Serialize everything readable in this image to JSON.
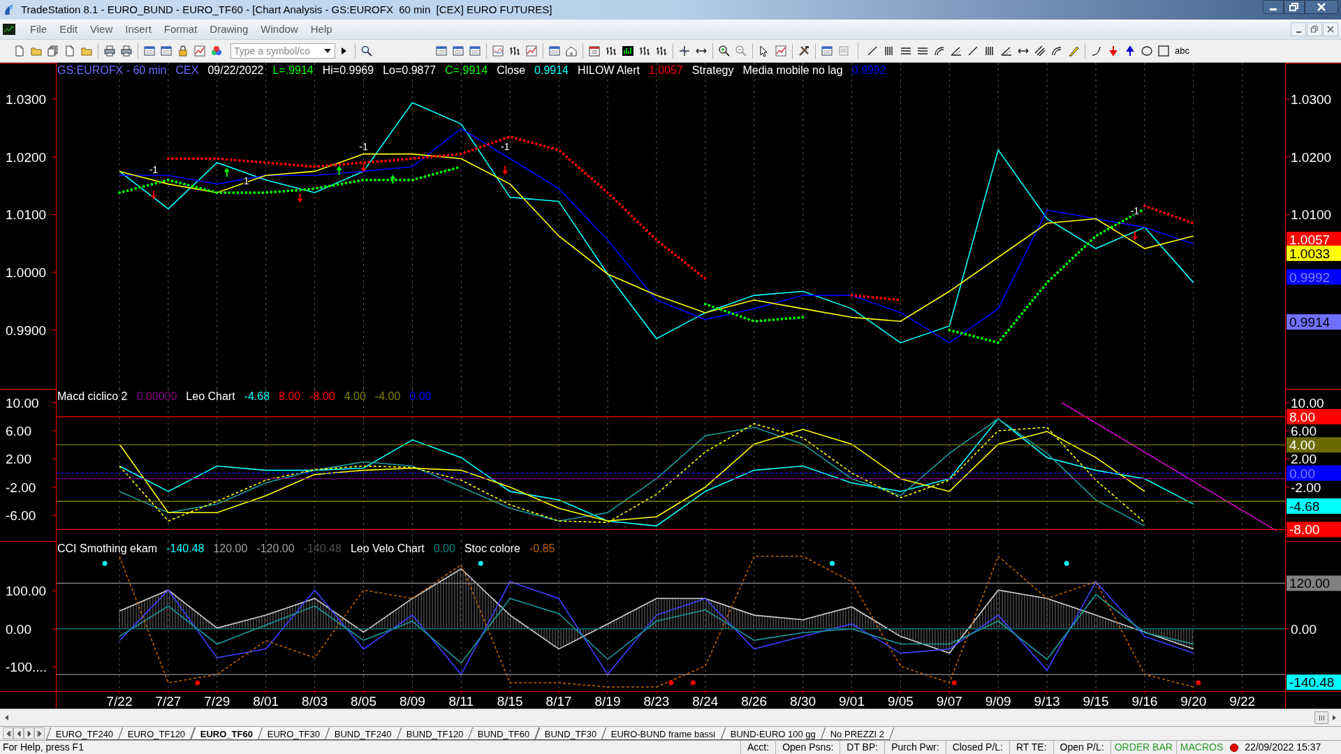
{
  "window": {
    "title": "TradeStation 8.1 - EURO_BUND - EURO_TF60 - [Chart Analysis - GS:EUROFX  60 min  [CEX] EURO FUTURES]"
  },
  "menu": [
    "File",
    "Edit",
    "View",
    "Insert",
    "Format",
    "Drawing",
    "Window",
    "Help"
  ],
  "toolbar": {
    "symbol_field": {
      "placeholder": "Type a symbol/co"
    },
    "text_tool": "abc"
  },
  "panels": [
    {
      "header": [
        {
          "text": "GS:EUROFX - 60 min",
          "color": "#6b6bff"
        },
        {
          "text": "CEX",
          "color": "#6b6bff"
        },
        {
          "text": "09/22/2022",
          "color": "#ffffff"
        },
        {
          "text": "L=.9914",
          "color": "#00ff00"
        },
        {
          "text": "Hi=0.9969",
          "color": "#ffffff"
        },
        {
          "text": "Lo=0.9877",
          "color": "#ffffff"
        },
        {
          "text": "C=.9914",
          "color": "#00ff00"
        },
        {
          "text": "Close",
          "color": "#ffffff"
        },
        {
          "text": "0.9914",
          "color": "#00ffff"
        },
        {
          "text": "HILOW Alert",
          "color": "#ffffff"
        },
        {
          "text": "1.0057",
          "color": "#ff0000"
        },
        {
          "text": "Strategy",
          "color": "#ffffff"
        },
        {
          "text": "Media mobile no lag",
          "color": "#ffffff"
        },
        {
          "text": "0.9992",
          "color": "#0000ff"
        }
      ],
      "signal_labels": [
        "-1",
        "1",
        "-1",
        "-1",
        "-1"
      ],
      "right_axis": [
        {
          "text": "1.0300",
          "kind": "tick"
        },
        {
          "text": "1.0200",
          "kind": "tick"
        },
        {
          "text": "1.0100",
          "kind": "tick"
        },
        {
          "text": "1.0057",
          "kind": "badge",
          "color": "#ff0000"
        },
        {
          "text": "1.0033",
          "kind": "badge",
          "color": "#ffff00"
        },
        {
          "text": "0.9992",
          "kind": "badge",
          "color": "#0000ff"
        },
        {
          "text": "0.9914",
          "kind": "badge",
          "color": "#7070ff"
        }
      ],
      "chart_data": {
        "type": "line",
        "grid": true,
        "ylim": [
          0.9798,
          1.0363
        ],
        "yticks": [
          {
            "value": 1.03,
            "label": "1.0300"
          },
          {
            "value": 1.02,
            "label": "1.0200"
          },
          {
            "value": 1.01,
            "label": "1.0100"
          },
          {
            "value": 1.0,
            "label": "1.0000"
          },
          {
            "value": 0.99,
            "label": "0.9900"
          }
        ],
        "series": [
          {
            "color": "#00ffff",
            "line_style": "solid",
            "values": [
              1.0175,
              1.011,
              1.019,
              1.016,
              1.0138,
              1.0175,
              1.0294,
              1.0257,
              1.013,
              1.0123,
              0.9997,
              0.9885,
              0.993,
              0.996,
              0.9967,
              0.9937,
              0.9878,
              0.9907,
              1.0212,
              1.0093,
              1.0041,
              1.0078,
              0.9982,
              null
            ]
          },
          {
            "color": "#0000ff",
            "line_style": "solid",
            "values": [
              1.0168,
              1.0168,
              1.0153,
              1.0168,
              1.0168,
              1.0175,
              1.0183,
              1.0249,
              1.0197,
              1.0145,
              1.0056,
              0.9952,
              0.9918,
              0.9937,
              0.996,
              0.996,
              0.993,
              0.9878,
              0.9937,
              1.0108,
              1.0093,
              1.0078,
              1.0049,
              null
            ]
          },
          {
            "color": "#ffff00",
            "line_style": "solid",
            "values": [
              1.0175,
              1.0153,
              1.0138,
              1.0168,
              1.0175,
              1.0205,
              1.0205,
              1.0197,
              1.0153,
              1.0063,
              0.9997,
              0.996,
              0.993,
              0.9952,
              0.9937,
              0.9922,
              0.9915,
              0.9967,
              1.0026,
              1.0085,
              1.0093,
              1.0041,
              1.0063,
              null
            ]
          },
          {
            "color": "#ff0000",
            "line_style": "dotted",
            "values": [
              null,
              1.0197,
              1.0197,
              1.019,
              1.0183,
              1.019,
              1.0197,
              1.0205,
              1.0235,
              1.0212,
              1.0138,
              1.0056,
              0.9989,
              null,
              null,
              0.996,
              0.9952,
              null,
              null,
              null,
              null,
              1.0115,
              1.0085,
              null
            ]
          },
          {
            "color": "#00ff00",
            "line_style": "dotted",
            "values": [
              1.0138,
              1.016,
              1.0138,
              1.0138,
              1.0145,
              1.016,
              1.016,
              1.0183,
              null,
              null,
              null,
              null,
              0.9945,
              0.9915,
              0.9922,
              null,
              null,
              0.99,
              0.9878,
              0.9982,
              1.0063,
              1.011,
              null,
              null
            ]
          }
        ]
      }
    },
    {
      "header": [
        {
          "text": "Macd ciclico 2",
          "color": "#ffffff"
        },
        {
          "text": "0.00000",
          "color": "#800080"
        },
        {
          "text": "Leo Chart",
          "color": "#ffffff"
        },
        {
          "text": "-4.68",
          "color": "#00ffff"
        },
        {
          "text": "8.00",
          "color": "#ff0000"
        },
        {
          "text": "-8.00",
          "color": "#ff0000"
        },
        {
          "text": "4.00",
          "color": "#808000"
        },
        {
          "text": "-4.00",
          "color": "#808000"
        },
        {
          "text": "0.00",
          "color": "#0000ff"
        }
      ],
      "right_axis": [
        {
          "text": "10.00",
          "kind": "tick"
        },
        {
          "text": "8.00",
          "kind": "badge",
          "color": "#ff0000"
        },
        {
          "text": "6.00",
          "kind": "tick"
        },
        {
          "text": "4.00",
          "kind": "badge",
          "color": "#6b6b00"
        },
        {
          "text": "2.00",
          "kind": "tick"
        },
        {
          "text": "0.00",
          "kind": "badge",
          "color": "#0000ff"
        },
        {
          "text": "-2.00",
          "kind": "tick"
        },
        {
          "text": "-4.68",
          "kind": "badge",
          "color": "#00ffff"
        },
        {
          "text": "-8.00",
          "kind": "badge",
          "color": "#ff0000"
        }
      ],
      "chart_data": {
        "type": "line",
        "grid": true,
        "ylim": [
          -9.64,
          11.94
        ],
        "yticks": [
          {
            "value": 10,
            "label": "10.00"
          },
          {
            "value": 6,
            "label": "6.00"
          },
          {
            "value": 2,
            "label": "2.00"
          },
          {
            "value": -2,
            "label": "-2.00"
          },
          {
            "value": -6,
            "label": "-6.00"
          }
        ],
        "series": [
          {
            "color": "#00ffff",
            "line_style": "solid",
            "values": [
              1.0,
              -2.6,
              1.0,
              0.4,
              0.4,
              0.7,
              4.7,
              2.2,
              -2.6,
              -3.8,
              -6.8,
              -7.5,
              -2.6,
              0.4,
              1.0,
              -1.4,
              -2.6,
              -0.8,
              7.7,
              2.2,
              0.4,
              -0.8,
              -4.4,
              null
            ]
          },
          {
            "color": "#1a9a9a",
            "line_style": "solid",
            "values": [
              -2.6,
              -5.6,
              -4.4,
              -1.4,
              0.4,
              1.6,
              1.0,
              -2.0,
              -5.0,
              -6.8,
              -5.6,
              -0.8,
              5.3,
              6.5,
              4.1,
              -0.8,
              -3.2,
              2.8,
              7.7,
              2.8,
              -3.8,
              -7.5,
              null,
              null
            ]
          },
          {
            "color": "#ffff00",
            "line_style": "solid",
            "values": [
              4.1,
              -5.6,
              -5.6,
              -3.2,
              -0.2,
              0.4,
              0.7,
              0.4,
              -2.0,
              -5.0,
              -6.8,
              -6.2,
              -2.0,
              4.1,
              6.2,
              4.1,
              -0.8,
              -2.6,
              4.1,
              5.9,
              2.2,
              -2.6,
              null,
              null
            ]
          },
          {
            "color": "#ffff00",
            "line_style": "dashed",
            "values": [
              1.0,
              -6.8,
              -4.0,
              -1.0,
              0.5,
              1.0,
              0.8,
              -1.0,
              -4.5,
              -6.8,
              -7.0,
              -3.0,
              3.0,
              7.0,
              5.0,
              0.0,
              -3.5,
              -1.0,
              6.0,
              6.5,
              -1.0,
              -7.0,
              null,
              null
            ]
          }
        ]
      }
    },
    {
      "header": [
        {
          "text": "CCI Smothing ekam",
          "color": "#ffffff"
        },
        {
          "text": "-140.48",
          "color": "#00ffff"
        },
        {
          "text": "120.00",
          "color": "#a0a0a0"
        },
        {
          "text": "-120.00",
          "color": "#a0a0a0"
        },
        {
          "text": "-140.48",
          "color": "#505050"
        },
        {
          "text": "Leo Velo Chart",
          "color": "#ffffff"
        },
        {
          "text": "0.00",
          "color": "#008080"
        },
        {
          "text": "Stoc colore",
          "color": "#ffffff"
        },
        {
          "text": "-0.85",
          "color": "#c06000"
        }
      ],
      "histogram": true,
      "right_axis": [
        {
          "text": "120.00",
          "kind": "badge",
          "color": "#808080"
        },
        {
          "text": "0.00",
          "kind": "tick"
        },
        {
          "text": "-140.48",
          "kind": "badge",
          "color": "#00ffff"
        }
      ],
      "chart_data": {
        "type": "line",
        "grid": true,
        "ylim": [
          -164,
          231
        ],
        "categories": [
          "7/22",
          "7/27",
          "7/29",
          "8/01",
          "8/03",
          "8/05",
          "8/09",
          "8/11",
          "8/15",
          "8/17",
          "8/19",
          "8/23",
          "8/24",
          "8/26",
          "8/30",
          "9/01",
          "9/05",
          "9/07",
          "9/09",
          "9/13",
          "9/15",
          "9/16",
          "9/20",
          "9/22"
        ],
        "yticks": [
          {
            "value": 100,
            "label": "100.00"
          },
          {
            "value": 0,
            "label": "0.00"
          },
          {
            "value": -100,
            "label": "-100...."
          }
        ],
        "series": [
          {
            "color": "#d0d0d0",
            "line_style": "solid",
            "values": [
              47,
              102,
              2,
              36,
              80,
              -9,
              80,
              158,
              36,
              -53,
              13,
              80,
              80,
              36,
              24,
              58,
              -20,
              -64,
              102,
              80,
              36,
              -9,
              -53,
              null
            ]
          },
          {
            "color": "#4040ff",
            "line_style": "solid",
            "values": [
              -31,
              102,
              -76,
              -53,
              102,
              -53,
              36,
              -120,
              124,
              80,
              -120,
              36,
              80,
              -53,
              -20,
              13,
              -64,
              -53,
              36,
              -109,
              124,
              -20,
              -64,
              null
            ]
          },
          {
            "color": "#1a9a9a",
            "line_style": "solid",
            "values": [
              -20,
              60,
              -40,
              10,
              60,
              -30,
              20,
              -90,
              80,
              40,
              -80,
              20,
              50,
              -30,
              -10,
              0,
              -40,
              -40,
              20,
              -80,
              90,
              -10,
              -40,
              null
            ]
          },
          {
            "color": "#c06000",
            "line_style": "dashed",
            "values": [
              191,
              -142,
              -120,
              -31,
              -76,
              102,
              80,
              169,
              -142,
              -142,
              -153,
              -153,
              -98,
              191,
              191,
              124,
              -98,
              -142,
              191,
              80,
              124,
              -120,
              -153,
              null
            ]
          }
        ]
      }
    }
  ],
  "tabs": [
    {
      "label": "EURO_TF240",
      "selected": false
    },
    {
      "label": "EURO_TF120",
      "selected": false
    },
    {
      "label": "EURO_TF60",
      "selected": true
    },
    {
      "label": "EURO_TF30",
      "selected": false
    },
    {
      "label": "BUND_TF240",
      "selected": false
    },
    {
      "label": "BUND_TF120",
      "selected": false
    },
    {
      "label": "BUND_TF60",
      "selected": false
    },
    {
      "label": "BUND_TF30",
      "selected": false
    },
    {
      "label": "EURO-BUND frame bassi",
      "selected": false
    },
    {
      "label": "BUND-EURO 100 gg",
      "selected": false
    },
    {
      "label": "No PREZZI 2",
      "selected": false
    }
  ],
  "status_bar": {
    "help": "For Help, press F1",
    "fields": [
      "Acct:",
      "Open Psns:",
      "DT BP:",
      "Purch Pwr:",
      "Closed P/L:",
      "RT TE:",
      "Open P/L:"
    ],
    "indicators": [
      "ORDER BAR",
      "MACROS"
    ],
    "datetime": "22/09/2022 15:37"
  }
}
